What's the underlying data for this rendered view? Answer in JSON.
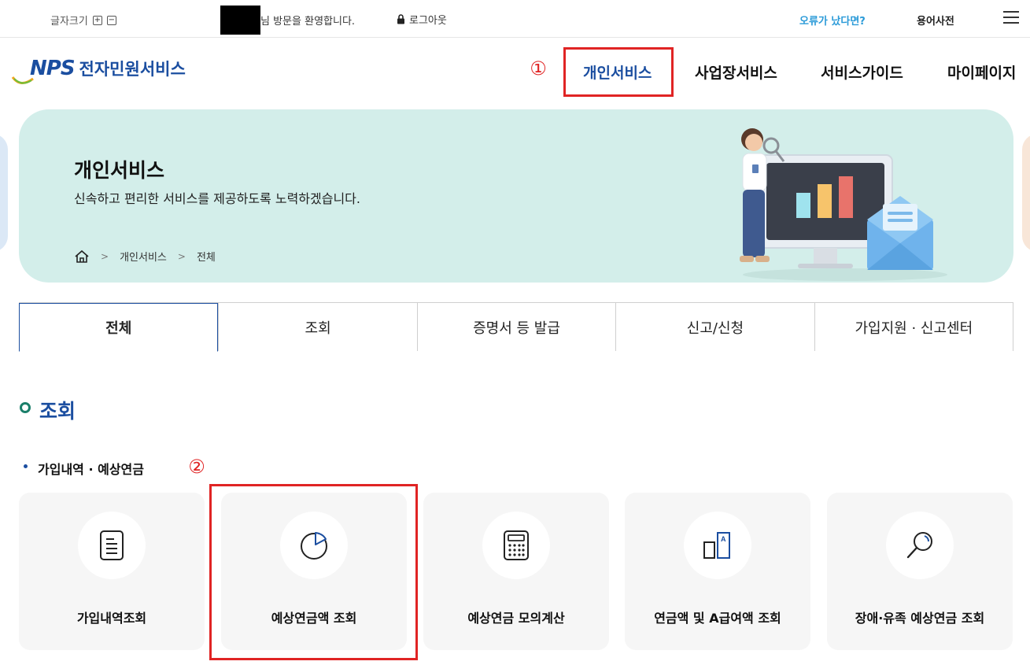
{
  "topbar": {
    "font_size_label": "글자크기",
    "font_plus": "+",
    "font_minus": "−",
    "welcome_text": "님 방문을 환영합니다.",
    "logout_label": "로그아웃",
    "error_link": "오류가 났다면?",
    "dictionary_link": "용어사전"
  },
  "header": {
    "logo_mark": "NPS",
    "logo_text": "전자민원서비스",
    "nav": [
      "개인서비스",
      "사업장서비스",
      "서비스가이드",
      "마이페이지"
    ],
    "active_nav": "개인서비스",
    "annotation_1": "①"
  },
  "banner": {
    "title": "개인서비스",
    "subtitle": "신속하고 편리한 서비스를 제공하도록 노력하겠습니다.",
    "breadcrumb": [
      "개인서비스",
      "전체"
    ]
  },
  "tabs": [
    "전체",
    "조회",
    "증명서 등 발급",
    "신고/신청",
    "가입지원 · 신고센터"
  ],
  "active_tab": "전체",
  "section": {
    "title": "조회",
    "subsection": "가입내역 · 예상연금",
    "annotation_2": "②",
    "cards": [
      {
        "label": "가입내역조회",
        "icon": "document-icon"
      },
      {
        "label": "예상연금액 조회",
        "icon": "pie-chart-icon"
      },
      {
        "label": "예상연금 모의계산",
        "icon": "calculator-icon"
      },
      {
        "label": "연금액 및 A급여액 조회",
        "icon": "compare-a-icon"
      },
      {
        "label": "장애·유족 예상연금 조회",
        "icon": "magnifier-icon"
      }
    ]
  },
  "colors": {
    "brand_blue": "#1b4ea0",
    "highlight_red": "#e02424",
    "banner_bg": "#d3eeea",
    "link_blue": "#2a9ad8"
  }
}
